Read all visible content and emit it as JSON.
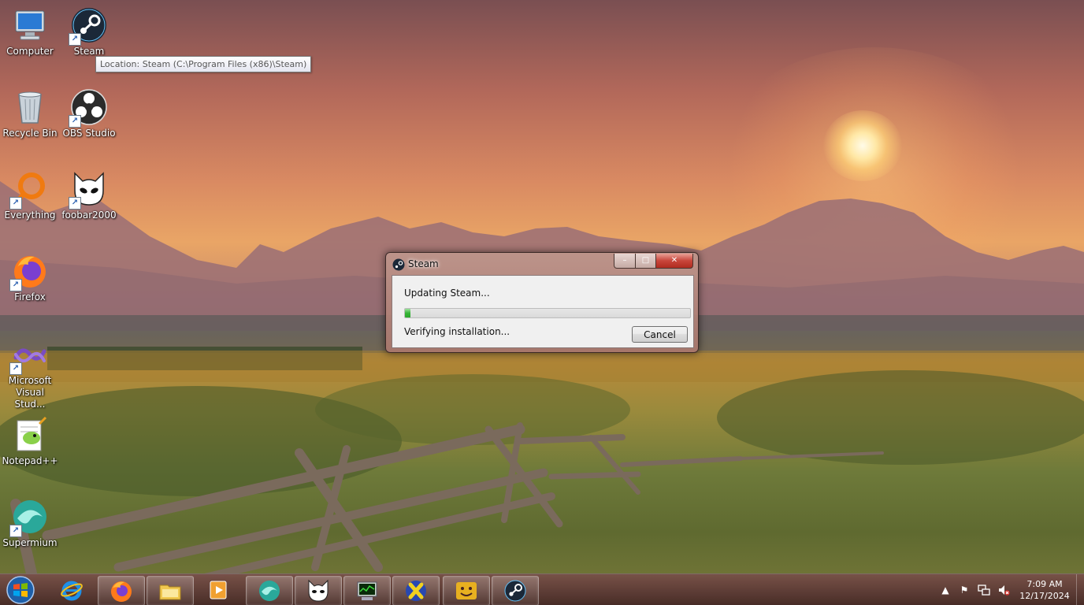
{
  "desktop": {
    "icons": [
      {
        "label": "Computer",
        "icon": "computer-icon"
      },
      {
        "label": "Steam",
        "icon": "steam-icon"
      },
      {
        "label": "Recycle Bin",
        "icon": "recycle-bin-icon"
      },
      {
        "label": "OBS Studio",
        "icon": "obs-studio-icon"
      },
      {
        "label": "Everything",
        "icon": "everything-search-icon"
      },
      {
        "label": "foobar2000",
        "icon": "foobar2000-icon"
      },
      {
        "label": "Firefox",
        "icon": "firefox-icon"
      },
      {
        "label": "Microsoft Visual Stud...",
        "icon": "visual-studio-icon"
      },
      {
        "label": "Notepad++",
        "icon": "notepad-plus-plus-icon"
      },
      {
        "label": "Supermium",
        "icon": "supermium-icon"
      }
    ],
    "tooltip": "Location: Steam (C:\\Program Files (x86)\\Steam)"
  },
  "dialog": {
    "title": "Steam",
    "status": "Updating Steam...",
    "progress": 0.02,
    "detail": "Verifying installation...",
    "cancel_label": "Cancel",
    "controls": {
      "minimize": "–",
      "maximize": "□",
      "close": "✕"
    }
  },
  "taskbar": {
    "items": [
      {
        "icon": "internet-explorer-icon",
        "running": false
      },
      {
        "icon": "firefox-icon",
        "running": true
      },
      {
        "icon": "file-explorer-icon",
        "running": true
      },
      {
        "icon": "media-player-icon",
        "running": false
      },
      {
        "icon": "supermium-icon",
        "running": true
      },
      {
        "icon": "foobar2000-icon",
        "running": true
      },
      {
        "icon": "task-manager-icon",
        "running": true
      },
      {
        "icon": "xming-x-icon",
        "running": true
      },
      {
        "icon": "smiley-app-icon",
        "running": true
      },
      {
        "icon": "steam-icon",
        "running": true
      }
    ],
    "clock": {
      "time": "7:09 AM",
      "date": "12/17/2024"
    }
  },
  "colors": {
    "progress_green": "#37b437",
    "close_red": "#c8453a"
  }
}
